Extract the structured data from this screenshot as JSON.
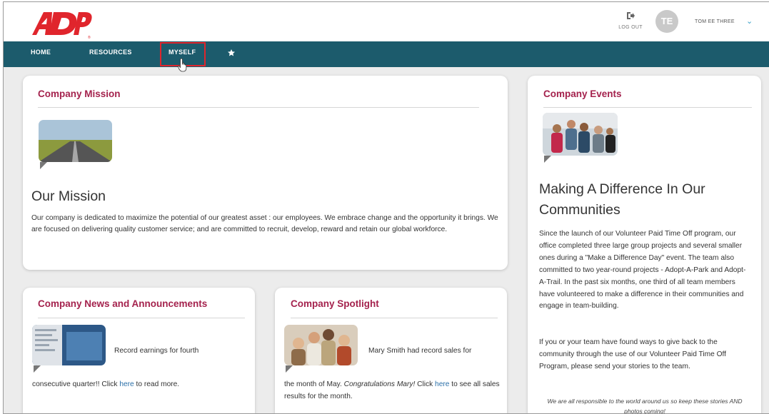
{
  "brand": {
    "logo_text": "ADP",
    "accent": "#e0252c",
    "nav_bg": "#1c5b6c",
    "title_color": "#a4224d"
  },
  "header": {
    "logout_label": "LOG OUT",
    "avatar_initials": "TE",
    "username": "TOM EE THREE"
  },
  "nav": {
    "items": [
      {
        "label": "HOME"
      },
      {
        "label": "RESOURCES"
      },
      {
        "label": "MYSELF"
      }
    ],
    "star_icon": "star-icon"
  },
  "mission": {
    "title": "Company Mission",
    "heading": "Our Mission",
    "body": "Our company is dedicated to maximize the potential of our greatest asset : our employees. We embrace change and the opportunity it brings. We are focused on delivering quality customer service; and are committed to recruit, develop, reward and retain our global workforce."
  },
  "events": {
    "title": "Company Events",
    "heading": "Making A Difference In Our Communities",
    "body1": "Since the launch of our Volunteer Paid Time Off program, our office completed three large group projects and several smaller ones during a \"Make a Difference Day\" event.  The team also committed to two year-round projects - Adopt-A-Park and Adopt-A-Trail.  In the past six months, one third of all team members have volunteered to make a difference in their communities and engage in team-building.",
    "body2": "If you or your team have found ways to give back to the community through the use of our Volunteer Paid Time Off Program, please send your stories to the team.",
    "quote": "We are all responsible to the world around us so keep these stories AND photos coming!"
  },
  "news": {
    "title": "Company News and Announcements",
    "text_a": "Record earnings for fourth",
    "text_b": "consecutive quarter!! Click ",
    "link": "here",
    "text_c": " to read more."
  },
  "spotlight": {
    "title": "Company Spotlight",
    "text_a": "Mary Smith had record sales for",
    "text_b": "the month of May. ",
    "text_italic": "Congratulations Mary!",
    "text_c": "  Click ",
    "link": "here",
    "text_d": " to see all sales results for the month."
  }
}
